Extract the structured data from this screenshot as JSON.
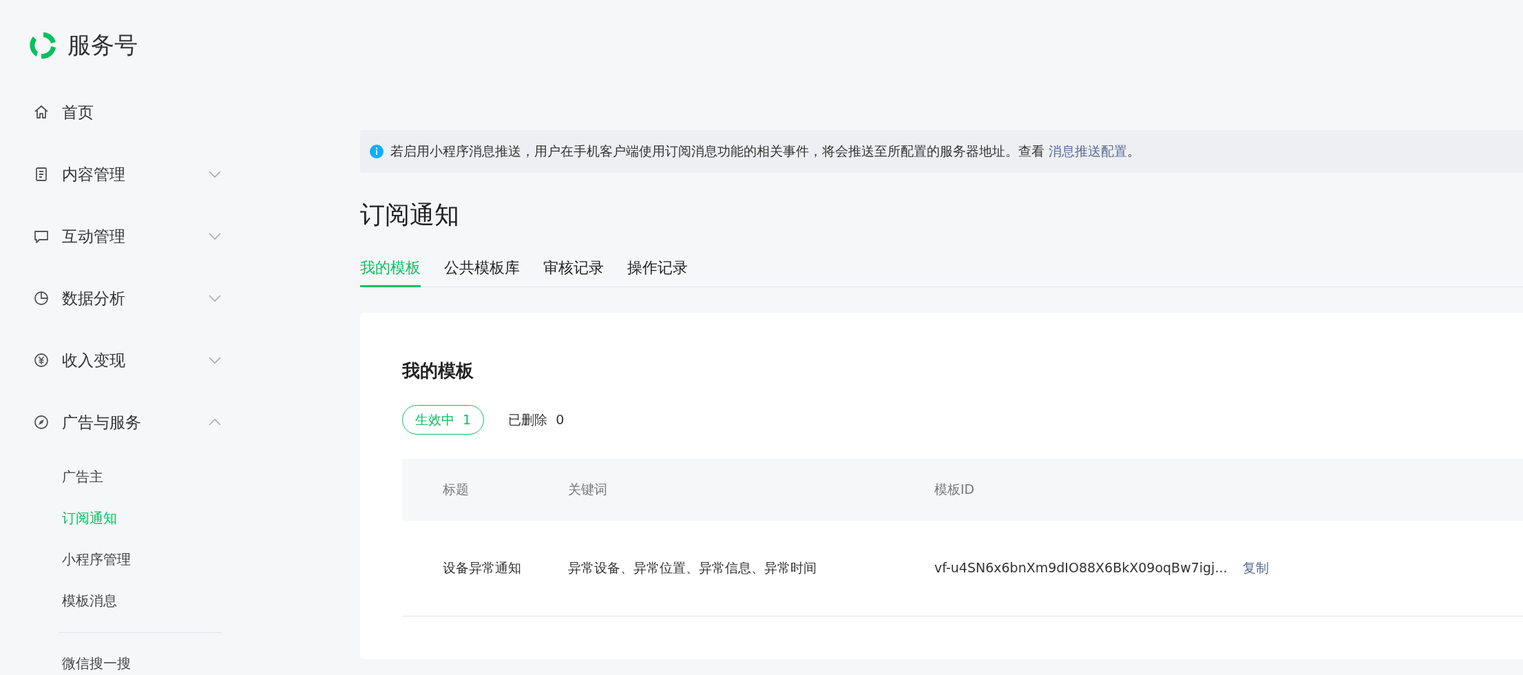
{
  "brand": {
    "name": "服务号"
  },
  "sidebar": {
    "items": [
      {
        "label": "首页",
        "kind": "link"
      },
      {
        "label": "内容管理",
        "kind": "group",
        "expanded": false
      },
      {
        "label": "互动管理",
        "kind": "group",
        "expanded": false
      },
      {
        "label": "数据分析",
        "kind": "group",
        "expanded": false
      },
      {
        "label": "收入变现",
        "kind": "group",
        "expanded": false
      },
      {
        "label": "广告与服务",
        "kind": "group",
        "expanded": true,
        "children": [
          {
            "label": "广告主",
            "selected": false
          },
          {
            "label": "订阅通知",
            "selected": true
          },
          {
            "label": "小程序管理",
            "selected": false
          },
          {
            "label": "模板消息",
            "selected": false
          }
        ]
      }
    ],
    "more_items": [
      {
        "label": "微信搜一搜",
        "selected": false
      }
    ]
  },
  "notice": {
    "text": "若启用小程序消息推送，用户在手机客户端使用订阅消息功能的相关事件，将会推送至所配置的服务器地址。查看 ",
    "link": "消息推送配置",
    "suffix": "。"
  },
  "page_title": "订阅通知",
  "tabs": [
    {
      "label": "我的模板",
      "selected": true
    },
    {
      "label": "公共模板库",
      "selected": false
    },
    {
      "label": "审核记录",
      "selected": false
    },
    {
      "label": "操作记录",
      "selected": false
    }
  ],
  "card": {
    "title": "我的模板",
    "filters": [
      {
        "label": "生效中",
        "count": "1",
        "selected": true
      },
      {
        "label": "已删除",
        "count": "0",
        "selected": false
      }
    ],
    "table": {
      "columns": [
        "标题",
        "关键词",
        "模板ID"
      ],
      "rows": [
        {
          "title": "设备异常通知",
          "keywords": "异常设备、异常位置、异常信息、异常时间",
          "template_id": "vf-u4SN6x6bnXm9dIO88X6BkX09oqBw7igj...",
          "action": "复制"
        }
      ]
    }
  }
}
